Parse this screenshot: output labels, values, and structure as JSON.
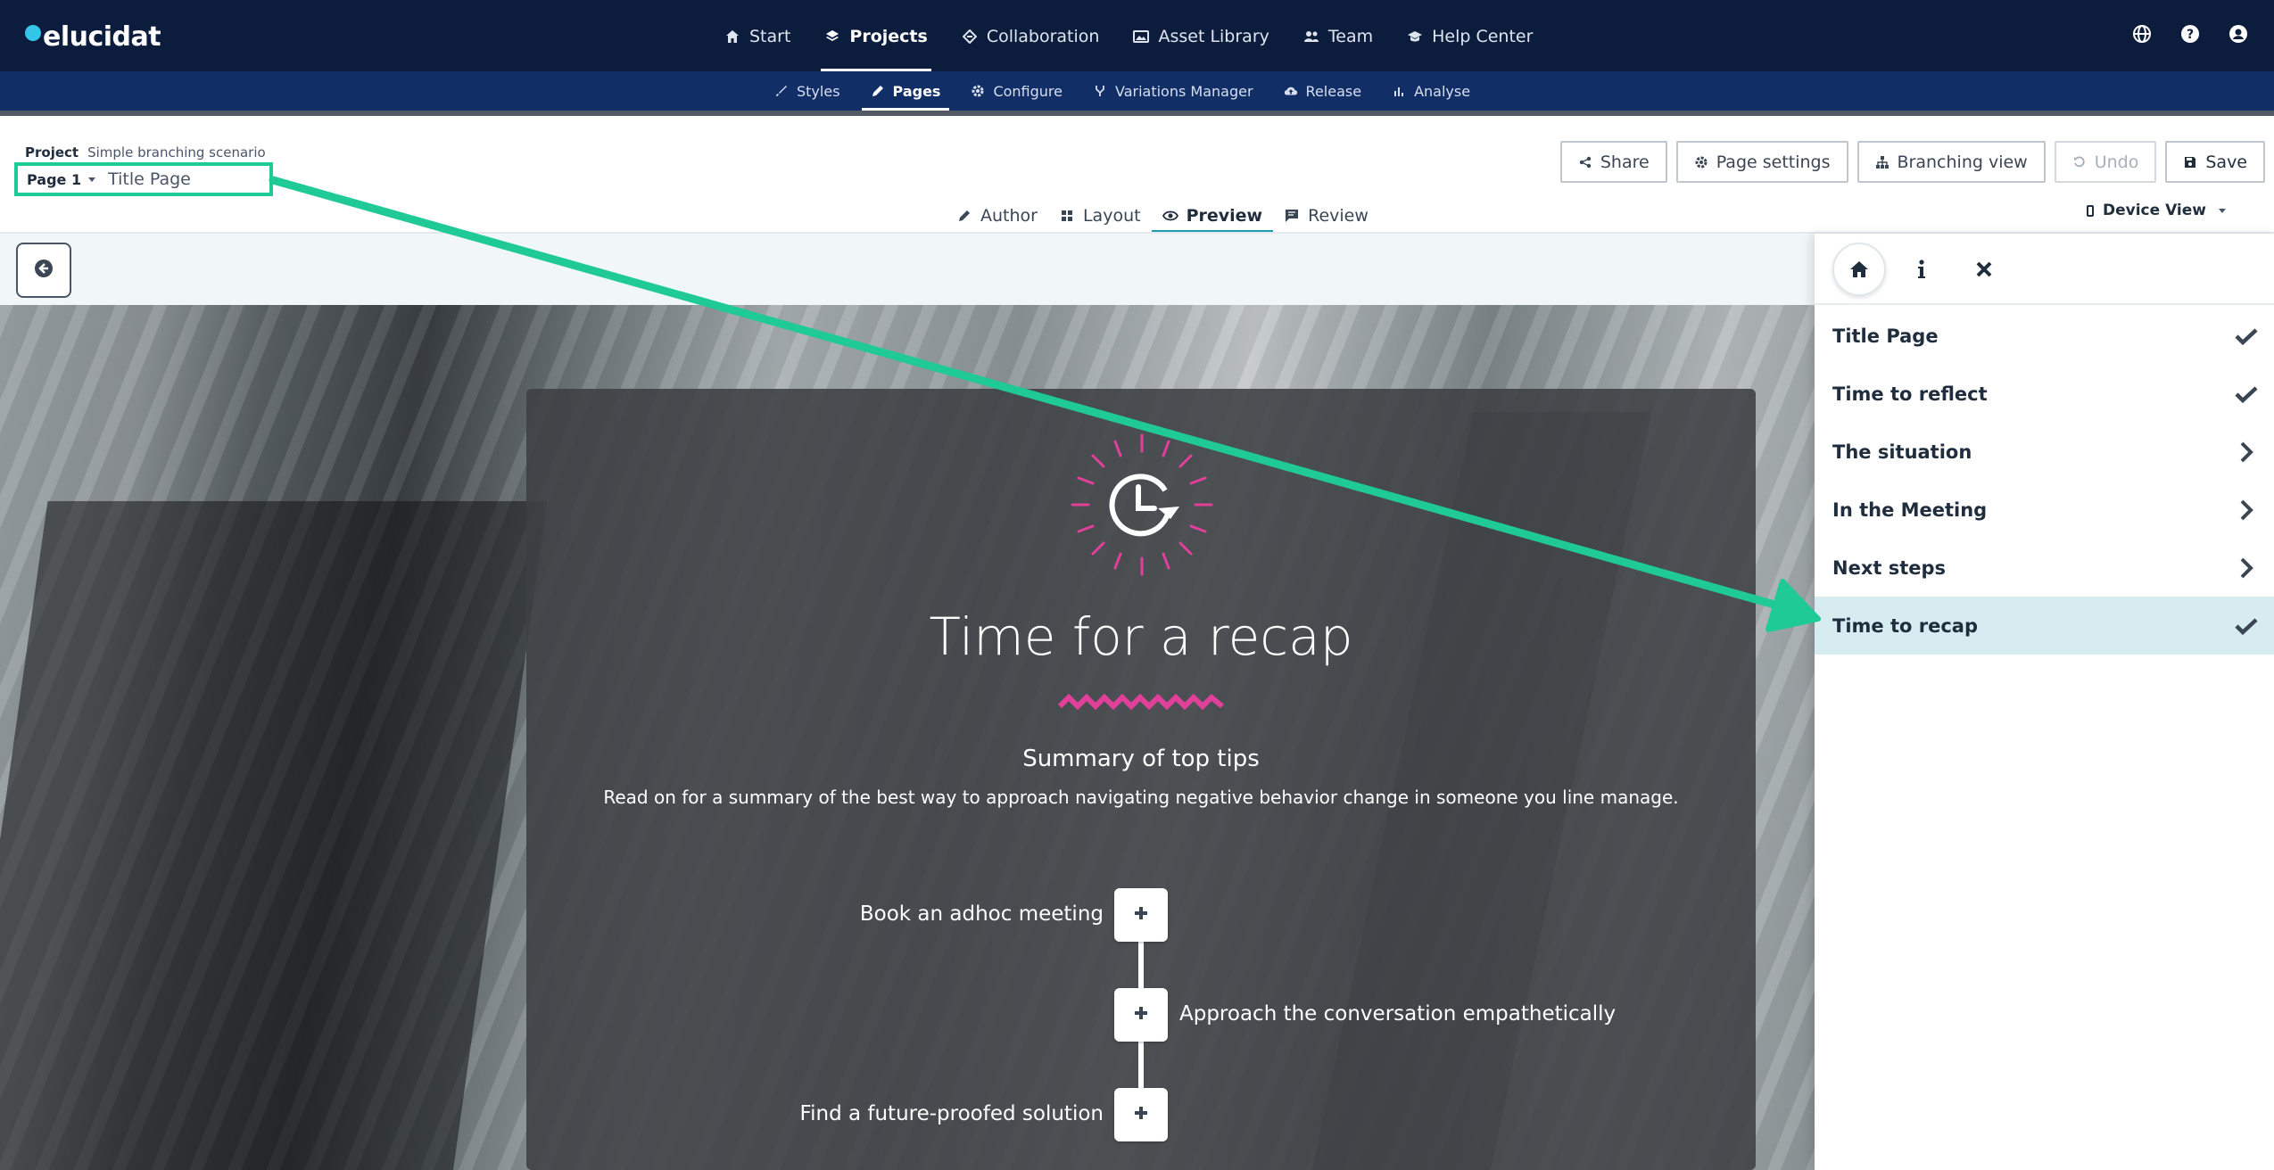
{
  "brand": {
    "logo_text": "elucidat",
    "logo_color": "#35c5e8"
  },
  "main_nav": {
    "items": [
      {
        "label": "Start",
        "icon": "home-icon"
      },
      {
        "label": "Projects",
        "icon": "layers-icon",
        "active": true
      },
      {
        "label": "Collaboration",
        "icon": "badge-icon"
      },
      {
        "label": "Asset Library",
        "icon": "images-icon"
      },
      {
        "label": "Team",
        "icon": "users-icon"
      },
      {
        "label": "Help Center",
        "icon": "graduation-cap-icon"
      }
    ],
    "right_icons": [
      "globe-icon",
      "help-icon",
      "user-account-icon"
    ]
  },
  "sub_nav": {
    "items": [
      {
        "label": "Styles",
        "icon": "brush-icon"
      },
      {
        "label": "Pages",
        "icon": "pencil-icon",
        "active": true
      },
      {
        "label": "Configure",
        "icon": "gear-icon"
      },
      {
        "label": "Variations Manager",
        "icon": "branch-icon"
      },
      {
        "label": "Release",
        "icon": "cloud-upload-icon"
      },
      {
        "label": "Analyse",
        "icon": "bar-chart-icon"
      }
    ]
  },
  "project": {
    "label": "Project",
    "name": "Simple branching scenario",
    "page_number": "Page 1",
    "page_title": "Title Page"
  },
  "actions": {
    "share": "Share",
    "page_settings": "Page settings",
    "branching_view": "Branching view",
    "undo": "Undo",
    "save": "Save"
  },
  "mode_tabs": [
    {
      "label": "Author",
      "icon": "pencil-icon"
    },
    {
      "label": "Layout",
      "icon": "grid-icon"
    },
    {
      "label": "Preview",
      "icon": "eye-icon",
      "active": true
    },
    {
      "label": "Review",
      "icon": "comment-icon"
    }
  ],
  "device_view": "Device View",
  "content": {
    "title": "Time for a recap",
    "summary_heading": "Summary of top tips",
    "summary_body": "Read on for a summary of the best way to approach navigating negative behavior change in someone you line manage.",
    "accent_color": "#e0409a",
    "timeline": [
      {
        "label": "Book an adhoc meeting",
        "side": "left"
      },
      {
        "label": "Approach the conversation empathetically",
        "side": "right"
      },
      {
        "label": "Find a future-proofed solution",
        "side": "left"
      }
    ]
  },
  "side_panel": {
    "tools": [
      "home-icon",
      "info-icon",
      "close-icon"
    ],
    "menu": [
      {
        "label": "Title Page",
        "status": "check"
      },
      {
        "label": "Time to reflect",
        "status": "check"
      },
      {
        "label": "The situation",
        "status": "chevron"
      },
      {
        "label": "In the Meeting",
        "status": "chevron"
      },
      {
        "label": "Next steps",
        "status": "chevron"
      },
      {
        "label": "Time to recap",
        "status": "check",
        "current": true
      }
    ]
  },
  "annotation": {
    "color": "#1fca97"
  }
}
